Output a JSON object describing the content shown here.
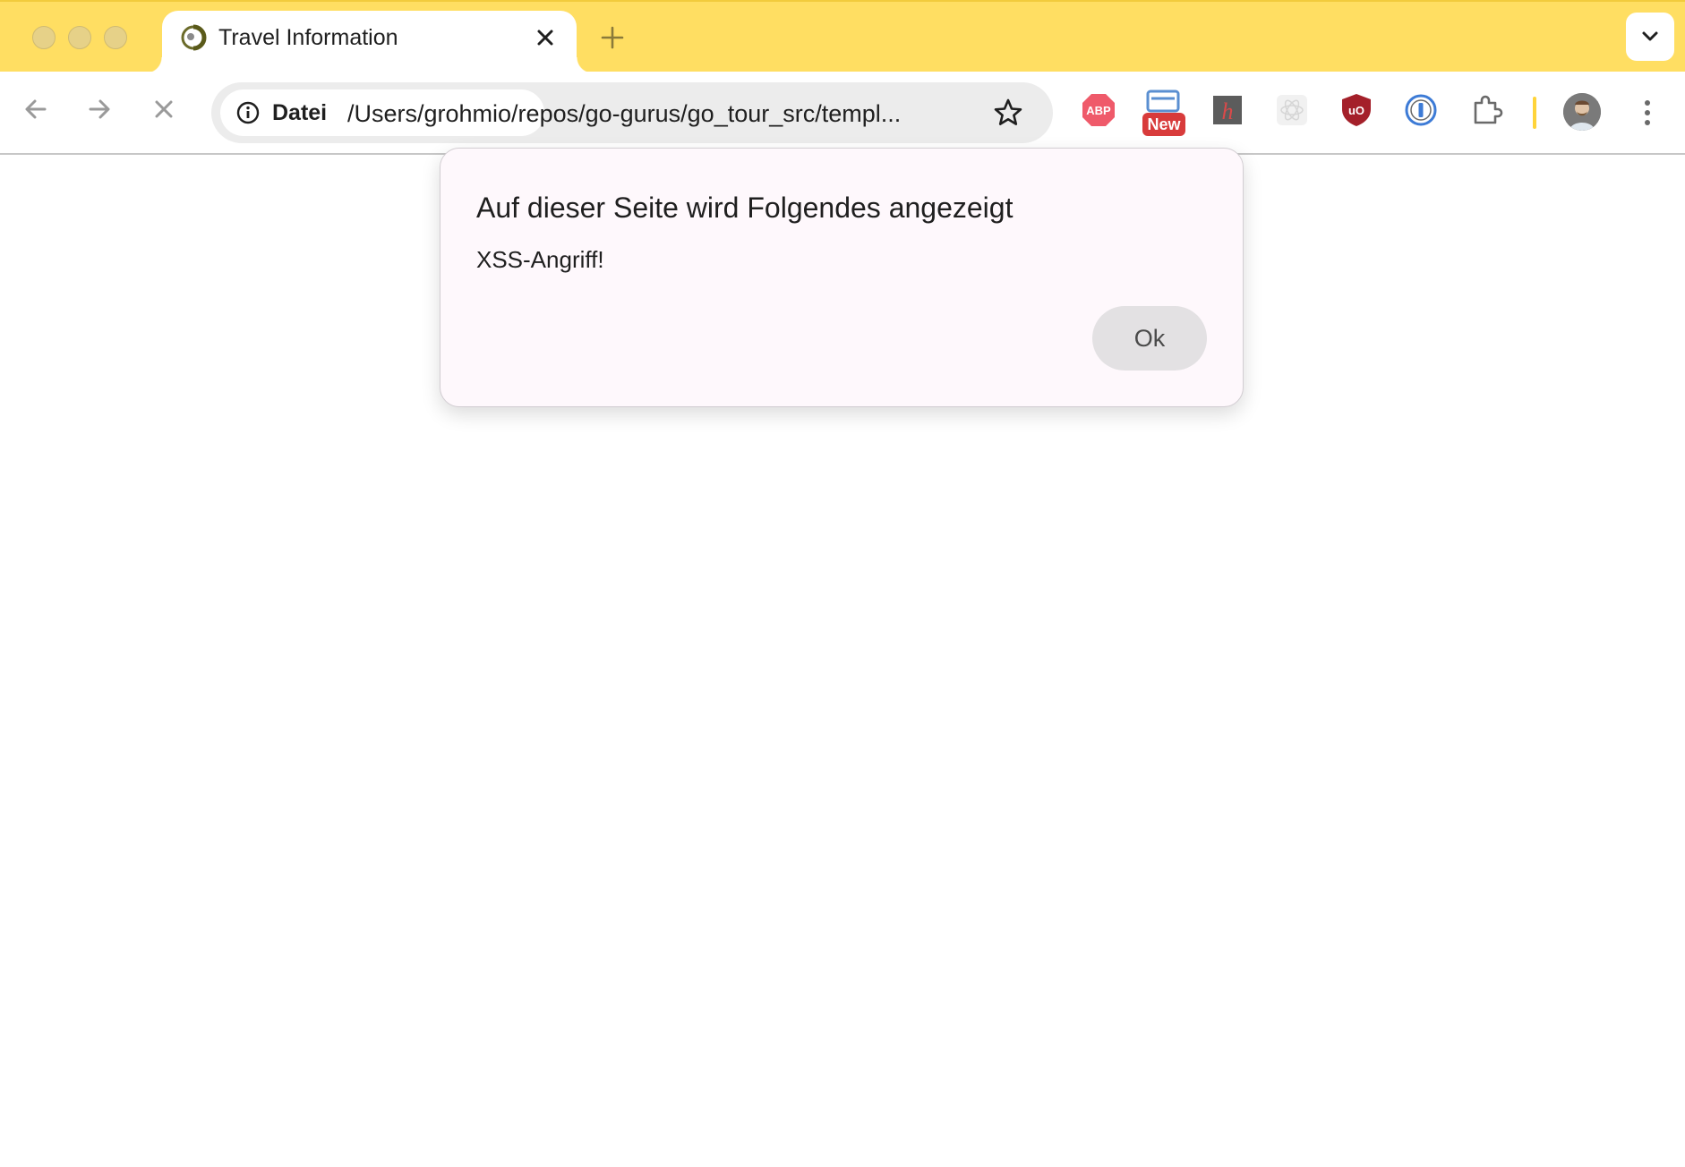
{
  "window": {
    "title_bar_color": "#ffde62"
  },
  "tab": {
    "title": "Travel Information",
    "favicon": "go-gopher-globe-icon",
    "close_icon": "close-icon"
  },
  "new_tab": {
    "icon": "plus-icon"
  },
  "tab_search": {
    "icon": "chevron-down-icon"
  },
  "toolbar": {
    "back_icon": "arrow-left-icon",
    "forward_icon": "arrow-right-icon",
    "stop_icon": "stop-loading-x-icon"
  },
  "omnibox": {
    "chip_icon": "info-icon",
    "chip_label": "Datei",
    "url": "/Users/grohmio/repos/go-gurus/go_tour_src/templ...",
    "bookmark_icon": "star-icon"
  },
  "extensions": {
    "adblock_label": "ABP",
    "new_badge": "New",
    "items": [
      "adblock-plus-icon",
      "window-extension-icon",
      "hypothesis-icon",
      "react-devtools-icon",
      "ublock-origin-icon",
      "1password-icon",
      "extensions-puzzle-icon"
    ]
  },
  "profile": {
    "icon": "avatar"
  },
  "menu": {
    "icon": "kebab-menu-icon"
  },
  "dialog": {
    "title": "Auf dieser Seite wird Folgendes angezeigt",
    "message": "XSS-Angriff!",
    "ok_label": "Ok"
  }
}
